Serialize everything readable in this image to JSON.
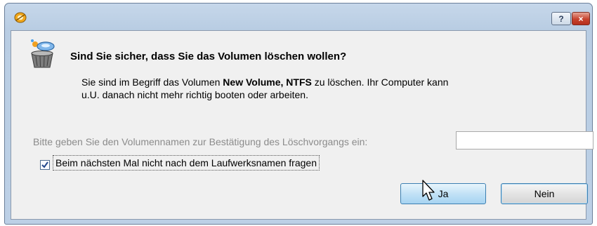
{
  "titlebar": {
    "help_label": "?",
    "close_label": "×"
  },
  "dialog": {
    "heading": "Sind Sie sicher, dass Sie das Volumen löschen wollen?",
    "message_part1": "Sie sind im Begriff das Volumen ",
    "volume_name": "New Volume, NTFS",
    "message_part2": " zu löschen. Ihr Computer kann",
    "message_line2": "u.U. danach nicht mehr richtig booten oder arbeiten.",
    "confirm_label": "Bitte geben Sie den Volumennamen zur Bestätigung des Löschvorgangs ein:",
    "confirm_value": "",
    "checkbox_label": "Beim nächsten Mal nicht nach dem Laufwerksnamen fragen",
    "checkbox_checked": true,
    "yes_label": "Ja",
    "no_label": "Nein"
  },
  "icons": {
    "app": "app-icon",
    "dialog": "wizard-icon",
    "cursor": "mouse-pointer-icon"
  },
  "colors": {
    "accent": "#3c7fb1",
    "close": "#c7422d"
  }
}
